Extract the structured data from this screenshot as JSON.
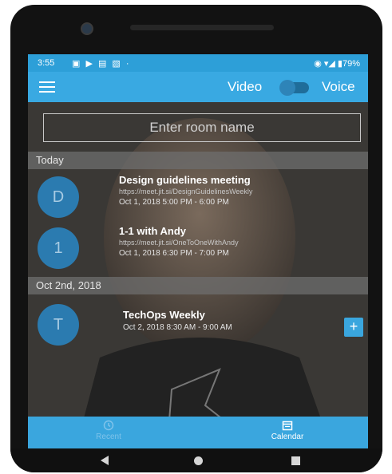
{
  "status_bar": {
    "time": "3:55",
    "notification_icons": "▣ ▶ ▤ ▧ ·",
    "right": "◉ ▾◢ ▮79%"
  },
  "app_bar": {
    "video_label": "Video",
    "voice_label": "Voice"
  },
  "room_input": {
    "placeholder": "Enter room name"
  },
  "sections": [
    {
      "header": "Today",
      "meetings": [
        {
          "initial": "D",
          "title": "Design guidelines meeting",
          "url": "https://meet.jit.si/DesignGuidelinesWeekly",
          "time": "Oct 1, 2018 5:00 PM - 6:00 PM"
        },
        {
          "initial": "1",
          "title": "1-1 with Andy",
          "url": "https://meet.jit.si/OneToOneWithAndy",
          "time": "Oct 1, 2018 6:30 PM - 7:00 PM"
        }
      ]
    },
    {
      "header": "Oct 2nd, 2018",
      "meetings": [
        {
          "initial": "T",
          "title": "TechOps Weekly",
          "time": "Oct 2, 2018 8:30 AM - 9:00 AM"
        }
      ]
    }
  ],
  "add_button": "+",
  "tabs": {
    "recent": "Recent",
    "calendar": "Calendar"
  },
  "colors": {
    "accent": "#39a9e2",
    "avatar": "#2b7bb0"
  }
}
